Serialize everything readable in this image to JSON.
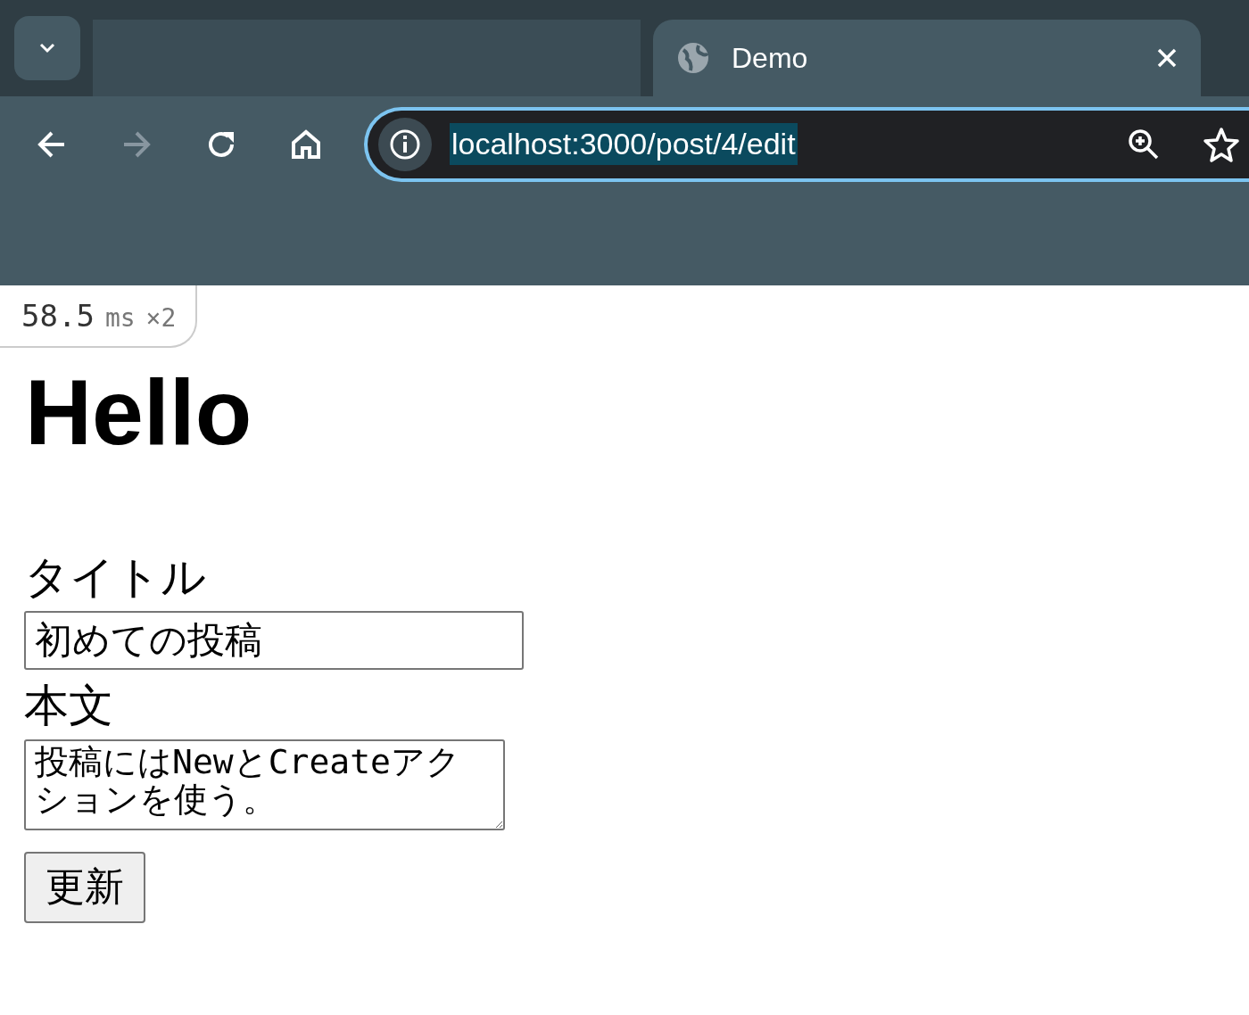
{
  "browser": {
    "tabs": [
      {
        "selected": false
      },
      {
        "title": "Demo",
        "selected": true
      }
    ],
    "nav": [
      {
        "kind": "back",
        "disabled": false
      },
      {
        "kind": "forward",
        "disabled": true
      },
      {
        "kind": "reload",
        "disabled": false
      },
      {
        "kind": "home",
        "disabled": false
      }
    ],
    "address": {
      "url": "localhost:3000/post/4/edit",
      "selected": true
    }
  },
  "timing_badge": {
    "value": "58.5",
    "unit": "ms",
    "count": "×2"
  },
  "heading": "Hello",
  "form": {
    "title_label": "タイトル",
    "title_value": "初めての投稿",
    "body_label": "本文",
    "body_value": "投稿にはNewとCreateアクションを使う。",
    "submit": "更新"
  }
}
